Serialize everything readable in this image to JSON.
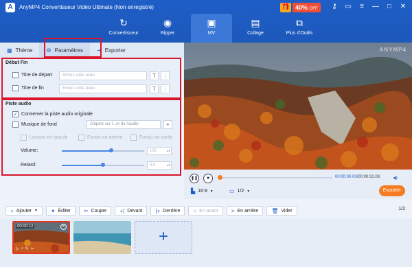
{
  "app": {
    "title": "AnyMP4 Convertisseur Vidéo Ultimate (Non enregistré)",
    "logo_letter": "A",
    "promo_percent": "40%",
    "promo_suffix": "OFF"
  },
  "window_controls": [
    {
      "name": "key-icon",
      "glyph": "⚷"
    },
    {
      "name": "chat-icon",
      "glyph": "▭"
    },
    {
      "name": "menu-icon",
      "glyph": "≡"
    },
    {
      "name": "minimize-icon",
      "glyph": "—"
    },
    {
      "name": "maximize-icon",
      "glyph": "□"
    },
    {
      "name": "close-icon",
      "glyph": "✕"
    }
  ],
  "nav": [
    {
      "label": "Convertisseur",
      "icon": "↻"
    },
    {
      "label": "Ripper",
      "icon": "◉"
    },
    {
      "label": "MV",
      "icon": "▣",
      "active": true
    },
    {
      "label": "Collage",
      "icon": "▤"
    },
    {
      "label": "Plus d'Outils",
      "icon": "⧉"
    }
  ],
  "tabs": {
    "theme": "Thème",
    "params": "Paramètres",
    "export": "Exporter"
  },
  "debut_fin": {
    "title": "Début Fin",
    "start_label": "Titre de départ",
    "end_label": "Titre de fin",
    "placeholder": "Entrez votre texte"
  },
  "audio": {
    "title": "Piste audio",
    "keep_label": "Conserver la piste audio originale",
    "keep_checked": "✓",
    "bg_label": "Musique de fond",
    "bg_select": "Cliquez sur l...er de l'audio",
    "loop_label": "Lecture en boucle",
    "fadein_label": "Fondu en entrée",
    "fadeout_label": "Fondu en sortie",
    "volume_label": "Volume:",
    "volume_value": "100",
    "volume_level": 0.6,
    "delay_label": "Retard:",
    "delay_value": "0,0",
    "delay_level": 0.5
  },
  "player": {
    "watermark": "ANYMP4",
    "time_current": "00:00:00.00",
    "time_total": "/00:00:31.08",
    "progress": 0.0,
    "ratio": "16:9",
    "split": "1/2",
    "export_label": "Exporter"
  },
  "toolbar": {
    "add": "Ajouter",
    "edit": "Éditer",
    "cut": "Couper",
    "front": "Devant",
    "back": "Derrière",
    "forward": "En avant",
    "backward": "En arrière",
    "clear": "Vider",
    "page": "1/2"
  },
  "timeline": {
    "clip1_time": "00:00:12"
  },
  "colors": {
    "brand_blue": "#1e5ec6",
    "accent_orange": "#f57c21",
    "highlight_red": "#d9142b"
  }
}
